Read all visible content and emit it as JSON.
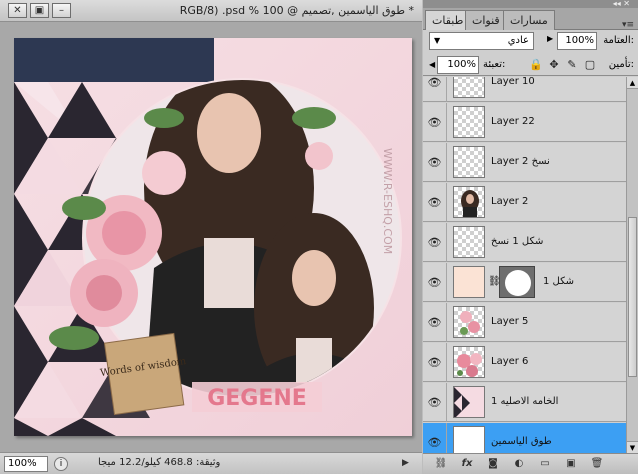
{
  "document": {
    "title": "* طوق الياسمين ,تصميم @ 100 % RGB/8) .psd",
    "zoom": "100%",
    "doc_info": "وثيقة: 468.8 كيلو/12.2 ميجا"
  },
  "artwork": {
    "watermark": "WWW.R-ESHQ.COM",
    "banner_text": "GEGENE",
    "tag_text": "Words of wisdom"
  },
  "panel": {
    "tabs": [
      "طبقات",
      "قنوات",
      "مسارات"
    ],
    "blend_mode": "عادي",
    "opacity_label": "العتامة:",
    "opacity": "100%",
    "lock_label": "تأمين:",
    "fill_label": "تعبئة:",
    "fill": "100%",
    "layers": [
      {
        "name": "Layer 10",
        "fx": "fx",
        "thumb": "blank",
        "selected": false
      },
      {
        "name": "Layer 22",
        "thumb": "blank",
        "selected": false
      },
      {
        "name": "Layer 2 نسخ",
        "thumb": "blank",
        "selected": false
      },
      {
        "name": "Layer 2",
        "thumb": "portrait",
        "selected": false
      },
      {
        "name": "شكل 1 نسخ",
        "thumb": "blank",
        "selected": false
      },
      {
        "name": "شكل 1",
        "thumb": "peach",
        "mask": true,
        "selected": false
      },
      {
        "name": "Layer 5",
        "thumb": "flowers",
        "selected": false
      },
      {
        "name": "Layer 6",
        "thumb": "flowers",
        "selected": false
      },
      {
        "name": "الخامه الاصليه 1",
        "thumb": "pattern",
        "selected": false
      },
      {
        "name": "طوق الياسمين",
        "thumb": "white",
        "selected": true
      }
    ]
  }
}
